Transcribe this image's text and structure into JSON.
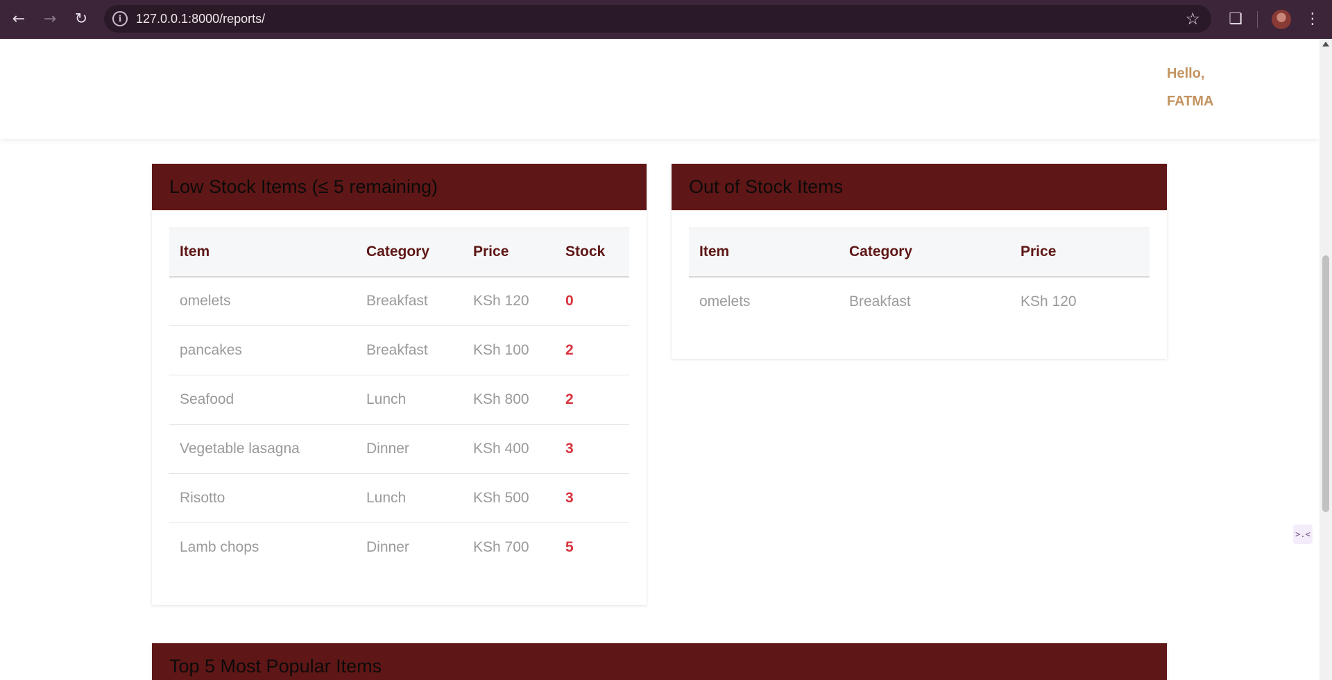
{
  "browser": {
    "url": "127.0.0.1:8000/reports/",
    "icons": [
      "back-icon",
      "forward-icon",
      "reload-icon",
      "site-info-icon",
      "bookmark-star-icon",
      "extensions-icon",
      "profile-avatar",
      "menu-icon"
    ]
  },
  "header": {
    "greeting_line1": "Hello,",
    "greeting_line2": "FATMA"
  },
  "low_stock": {
    "title": "Low Stock Items (≤ 5 remaining)",
    "columns": [
      "Item",
      "Category",
      "Price",
      "Stock"
    ],
    "rows": [
      {
        "item": "omelets",
        "category": "Breakfast",
        "price": "KSh 120",
        "stock": "0"
      },
      {
        "item": "pancakes",
        "category": "Breakfast",
        "price": "KSh 100",
        "stock": "2"
      },
      {
        "item": "Seafood",
        "category": "Lunch",
        "price": "KSh 800",
        "stock": "2"
      },
      {
        "item": "Vegetable lasagna",
        "category": "Dinner",
        "price": "KSh 400",
        "stock": "3"
      },
      {
        "item": "Risotto",
        "category": "Lunch",
        "price": "KSh 500",
        "stock": "3"
      },
      {
        "item": "Lamb chops",
        "category": "Dinner",
        "price": "KSh 700",
        "stock": "5"
      }
    ]
  },
  "out_of_stock": {
    "title": "Out of Stock Items",
    "columns": [
      "Item",
      "Category",
      "Price"
    ],
    "rows": [
      {
        "item": "omelets",
        "category": "Breakfast",
        "price": "KSh 120"
      }
    ]
  },
  "popular": {
    "title": "Top 5 Most Popular Items"
  },
  "colors": {
    "header_bg": "#5e1716",
    "accent_text": "#5e1716",
    "stock_red": "#d9333f",
    "greeting": "#c3935f",
    "chrome_bg": "#3c2439"
  }
}
